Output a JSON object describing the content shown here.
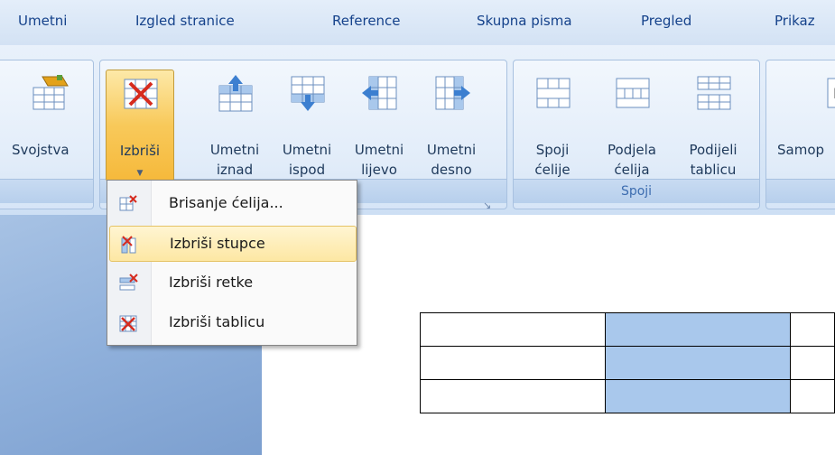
{
  "tabs": [
    "Umetni",
    "Izgled stranice",
    "Reference",
    "Skupna pisma",
    "Pregled",
    "Prikaz"
  ],
  "ribbon": {
    "buttons": {
      "svojstva": "Svojstva",
      "izbrisi": "Izbriši",
      "umetni_iznad": [
        "Umetni",
        "iznad"
      ],
      "umetni_ispod": [
        "Umetni",
        "ispod"
      ],
      "umetni_lijevo": [
        "Umetni",
        "lijevo"
      ],
      "umetni_desno": [
        "Umetni",
        "desno"
      ],
      "spoji_celije": [
        "Spoji",
        "ćelije"
      ],
      "podjela_celija": [
        "Podjela",
        "ćelija"
      ],
      "podijeli_tablicu": [
        "Podijeli",
        "tablicu"
      ],
      "samop": "Samop"
    },
    "groups": {
      "spoji": "Spoji"
    }
  },
  "menu": {
    "items": [
      {
        "label": "Brisanje ćelija...",
        "icon": "delete-cells-icon"
      },
      {
        "label": "Izbriši stupce",
        "icon": "delete-columns-icon",
        "highlighted": true
      },
      {
        "label": "Izbriši retke",
        "icon": "delete-rows-icon"
      },
      {
        "label": "Izbriši tablicu",
        "icon": "delete-table-icon"
      }
    ]
  },
  "colors": {
    "accent": "#15428b",
    "selected_cell": "#a9c8ec",
    "highlight": "#fde7a3"
  }
}
